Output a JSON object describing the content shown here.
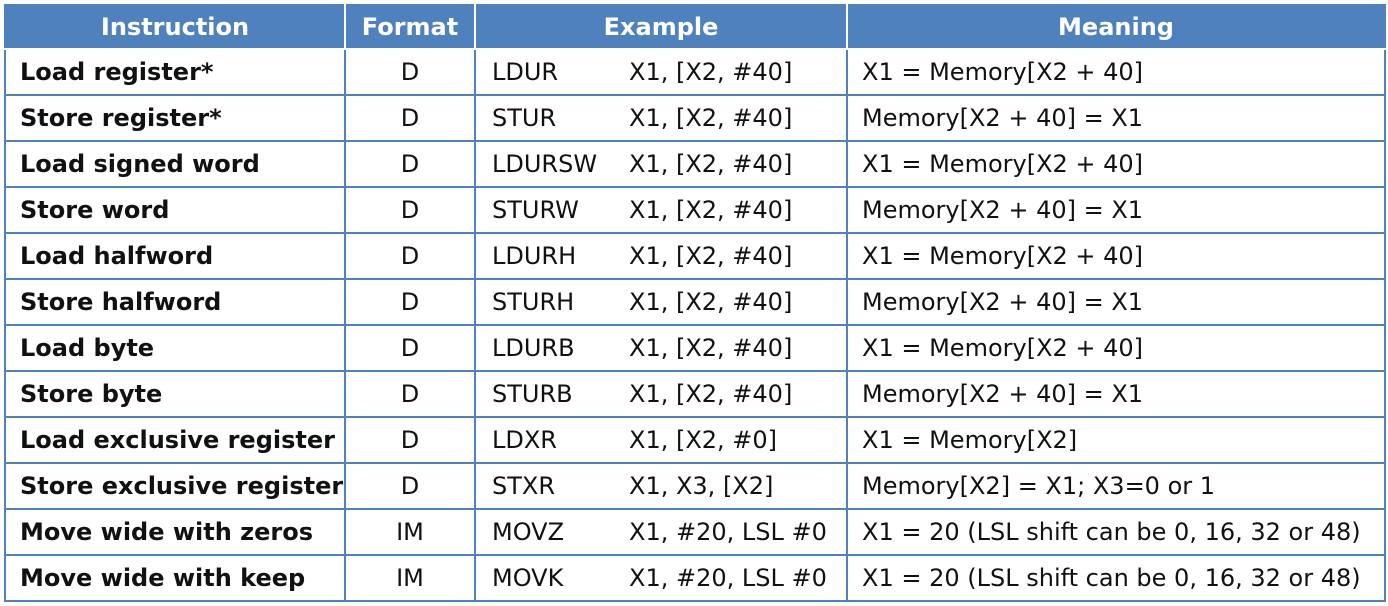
{
  "headers": {
    "instruction": "Instruction",
    "format": "Format",
    "example": "Example",
    "meaning": "Meaning"
  },
  "colors": {
    "header_bg": "#4f81bd",
    "header_text": "#ffffff",
    "border": "#4f81bd"
  },
  "rows": [
    {
      "instruction": "Load register*",
      "format": "D",
      "opcode": "LDUR",
      "operands": "X1, [X2, #40]",
      "meaning": "X1 = Memory[X2 + 40]"
    },
    {
      "instruction": "Store register*",
      "format": "D",
      "opcode": "STUR",
      "operands": "X1, [X2, #40]",
      "meaning": "Memory[X2 + 40] = X1"
    },
    {
      "instruction": "Load signed word",
      "format": "D",
      "opcode": "LDURSW",
      "operands": "X1, [X2, #40]",
      "meaning": "X1 = Memory[X2 + 40]"
    },
    {
      "instruction": "Store word",
      "format": "D",
      "opcode": "STURW",
      "operands": "X1, [X2, #40]",
      "meaning": "Memory[X2 + 40] = X1"
    },
    {
      "instruction": "Load halfword",
      "format": "D",
      "opcode": "LDURH",
      "operands": "X1, [X2, #40]",
      "meaning": "X1 = Memory[X2 + 40]"
    },
    {
      "instruction": "Store halfword",
      "format": "D",
      "opcode": "STURH",
      "operands": "X1, [X2, #40]",
      "meaning": "Memory[X2 + 40] = X1"
    },
    {
      "instruction": "Load byte",
      "format": "D",
      "opcode": "LDURB",
      "operands": "X1, [X2, #40]",
      "meaning": "X1 = Memory[X2 + 40]"
    },
    {
      "instruction": "Store byte",
      "format": "D",
      "opcode": "STURB",
      "operands": "X1, [X2, #40]",
      "meaning": "Memory[X2 + 40] = X1"
    },
    {
      "instruction": "Load exclusive register",
      "format": "D",
      "opcode": "LDXR",
      "operands": "X1, [X2, #0]",
      "meaning": "X1 = Memory[X2]"
    },
    {
      "instruction": "Store exclusive register",
      "format": "D",
      "opcode": "STXR",
      "operands": "X1, X3, [X2]",
      "meaning": "Memory[X2] = X1; X3=0 or 1"
    },
    {
      "instruction": "Move wide with zeros",
      "format": "IM",
      "opcode": "MOVZ",
      "operands": "X1, #20, LSL #0",
      "meaning": "X1 = 20 (LSL shift can be 0, 16, 32 or 48)"
    },
    {
      "instruction": "Move wide with keep",
      "format": "IM",
      "opcode": "MOVK",
      "operands": "X1, #20, LSL #0",
      "meaning": "X1 = 20 (LSL shift can be 0, 16, 32 or 48)"
    }
  ]
}
